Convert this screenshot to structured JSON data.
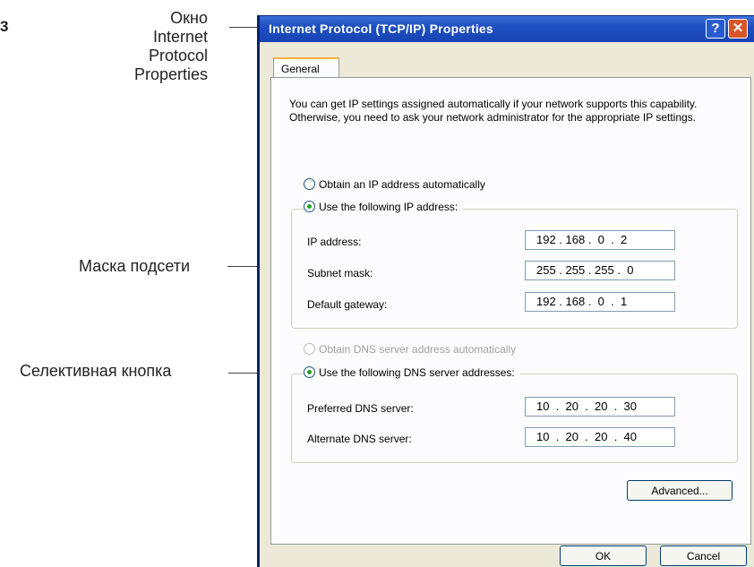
{
  "figure_number": "3",
  "callouts": {
    "window_label": "Окно\nInternet\nProtocol\nProperties",
    "subnet_label": "Маска подсети",
    "radio_label": "Селективная кнопка"
  },
  "dialog": {
    "title": "Internet Protocol (TCP/IP) Properties",
    "help_icon": "?",
    "close_icon": "✕",
    "tab": "General",
    "description": "You can get IP settings assigned automatically if your network supports this capability. Otherwise, you need to ask your network administrator for the appropriate IP settings.",
    "ip_auto": {
      "label": "Obtain an IP address automatically",
      "checked": false
    },
    "ip_manual": {
      "label": "Use the following IP address:",
      "checked": true
    },
    "ip_fields": [
      {
        "label": "IP address:",
        "value": "192 . 168 .  0  .  2"
      },
      {
        "label": "Subnet mask:",
        "value": "255 . 255 . 255 .  0"
      },
      {
        "label": "Default gateway:",
        "value": "192 . 168 .  0  .  1"
      }
    ],
    "dns_auto": {
      "label": "Obtain DNS server address automatically",
      "checked": false,
      "enabled": false
    },
    "dns_manual": {
      "label": "Use the following DNS server addresses:",
      "checked": true
    },
    "dns_fields": [
      {
        "label": "Preferred DNS server:",
        "value": "10  .  20  .  20  .  30"
      },
      {
        "label": "Alternate DNS server:",
        "value": "10  .  20  .  20  .  40"
      }
    ],
    "advanced_button": "Advanced...",
    "ok_button": "OK",
    "cancel_button": "Cancel"
  },
  "colors": {
    "titlebar": "#1e4fc0",
    "dialog_bg": "#ece9d8",
    "radio_checked": "#21a121"
  }
}
